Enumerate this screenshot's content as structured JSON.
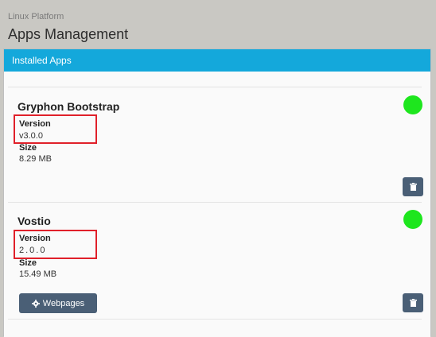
{
  "header": {
    "breadcrumb": "Linux Platform",
    "title": "Apps Management"
  },
  "panel": {
    "title": "Installed Apps"
  },
  "apps": [
    {
      "name": "Gryphon Bootstrap",
      "version_label": "Version",
      "version": "v3.0.0",
      "size_label": "Size",
      "size": "8.29 MB",
      "status": "running"
    },
    {
      "name": "Vostio",
      "version_label": "Version",
      "version": "2.0.0",
      "size_label": "Size",
      "size": "15.49 MB",
      "status": "running",
      "webpages_label": "Webpages"
    }
  ],
  "colors": {
    "panel_heading": "#14a8db",
    "status_green": "#1ee61e",
    "button": "#4a5f76",
    "highlight": "#e0202a"
  },
  "icons": [
    "trash-icon",
    "gear-icon"
  ]
}
